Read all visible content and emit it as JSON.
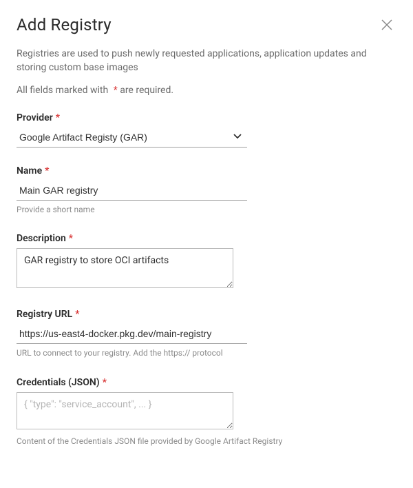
{
  "header": {
    "title": "Add Registry"
  },
  "intro": "Registries are used to push newly requested applications, application updates and storing custom base images",
  "required_note": {
    "before": "All fields marked with",
    "after": "are required."
  },
  "fields": {
    "provider": {
      "label": "Provider",
      "value": "Google Artifact Registy (GAR)"
    },
    "name": {
      "label": "Name",
      "value": "Main GAR registry",
      "helper": "Provide a short name"
    },
    "description": {
      "label": "Description",
      "value": "GAR registry to store OCI artifacts"
    },
    "registry_url": {
      "label": "Registry URL",
      "value": "https://us-east4-docker.pkg.dev/main-registry",
      "helper": "URL to connect to your registry. Add the https:// protocol"
    },
    "credentials": {
      "label": "Credentials (JSON)",
      "placeholder": "{ \"type\": \"service_account\", ... }",
      "value": "",
      "helper": "Content of the Credentials JSON file provided by Google Artifact Registry"
    }
  }
}
